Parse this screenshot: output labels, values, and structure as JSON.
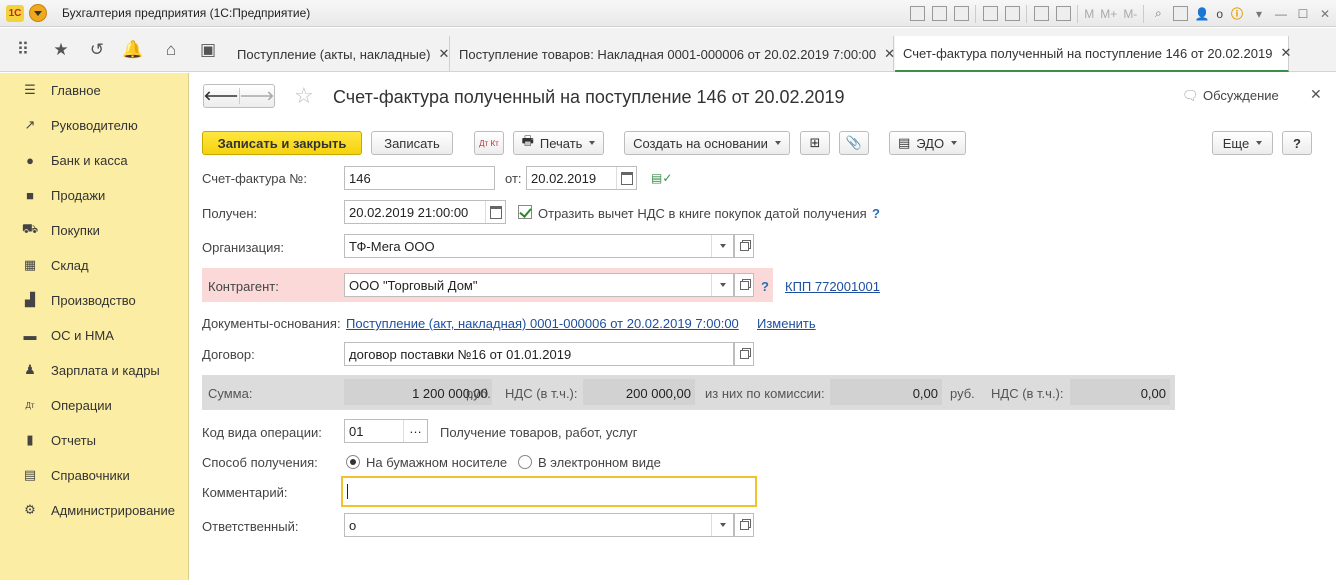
{
  "app": {
    "logo": "1С",
    "title": "Бухгалтерия предприятия  (1С:Предприятие)",
    "window_tools": [
      "M",
      "M+",
      "M-"
    ],
    "user": "о"
  },
  "tabs": [
    {
      "label": "Поступление (акты, накладные)"
    },
    {
      "label": "Поступление товаров: Накладная 0001-000006 от 20.02.2019 7:00:00"
    },
    {
      "label": "Счет-фактура полученный на поступление 146 от 20.02.2019"
    }
  ],
  "sidebar": {
    "items": [
      {
        "label": "Главное",
        "icon": "menu-icon"
      },
      {
        "label": "Руководителю",
        "icon": "chart-icon"
      },
      {
        "label": "Банк и касса",
        "icon": "coin-icon"
      },
      {
        "label": "Продажи",
        "icon": "bag-icon"
      },
      {
        "label": "Покупки",
        "icon": "cart-icon"
      },
      {
        "label": "Склад",
        "icon": "warehouse-icon"
      },
      {
        "label": "Производство",
        "icon": "factory-icon"
      },
      {
        "label": "ОС и НМА",
        "icon": "truck-icon"
      },
      {
        "label": "Зарплата и кадры",
        "icon": "person-icon"
      },
      {
        "label": "Операции",
        "icon": "dt-kt-icon"
      },
      {
        "label": "Отчеты",
        "icon": "bar-chart-icon"
      },
      {
        "label": "Справочники",
        "icon": "book-icon"
      },
      {
        "label": "Администрирование",
        "icon": "gear-icon"
      }
    ]
  },
  "form": {
    "title": "Счет-фактура полученный на поступление 146 от 20.02.2019",
    "discussion": "Обсуждение",
    "toolbar": {
      "save_close": "Записать и закрыть",
      "save": "Записать",
      "dtkt": "Дт Кт",
      "print": "Печать",
      "create_based": "Создать на основании",
      "edo": "ЭДО",
      "more": "Еще",
      "help": "?"
    },
    "invoice_label": "Счет-фактура №:",
    "invoice_number": "146",
    "from_label": "от:",
    "invoice_date": "20.02.2019",
    "received_label": "Получен:",
    "received_datetime": "20.02.2019 21:00:00",
    "vat_checkbox_label": "Отразить вычет НДС в книге покупок датой получения",
    "org_label": "Организация:",
    "org_value": "ТФ-Мега ООО",
    "counterparty_label": "Контрагент:",
    "counterparty_value": "ООО \"Торговый Дом\"",
    "kpp_link": "КПП 772001001",
    "docs_label": "Документы-основания:",
    "docs_link": "Поступление (акт, накладная) 0001-000006 от 20.02.2019 7:00:00",
    "change_link": "Изменить",
    "contract_label": "Договор:",
    "contract_value": "договор поставки №16 от 01.01.2019",
    "sum": {
      "label": "Сумма:",
      "amount": "1 200 000,00",
      "currency1": "руб.",
      "vat_label": "НДС (в т.ч.):",
      "vat_amount": "200 000,00",
      "commission_label": "из них по комиссии:",
      "commission_amount": "0,00",
      "currency2": "руб.",
      "vat2_label": "НДС (в т.ч.):",
      "vat2_amount": "0,00"
    },
    "op_code_label": "Код вида операции:",
    "op_code_value": "01",
    "op_code_desc": "Получение товаров, работ, услуг",
    "method_label": "Способ получения:",
    "method_paper": "На бумажном носителе",
    "method_electronic": "В электронном виде",
    "comment_label": "Комментарий:",
    "comment_value": "",
    "responsible_label": "Ответственный:",
    "responsible_value": "о"
  }
}
